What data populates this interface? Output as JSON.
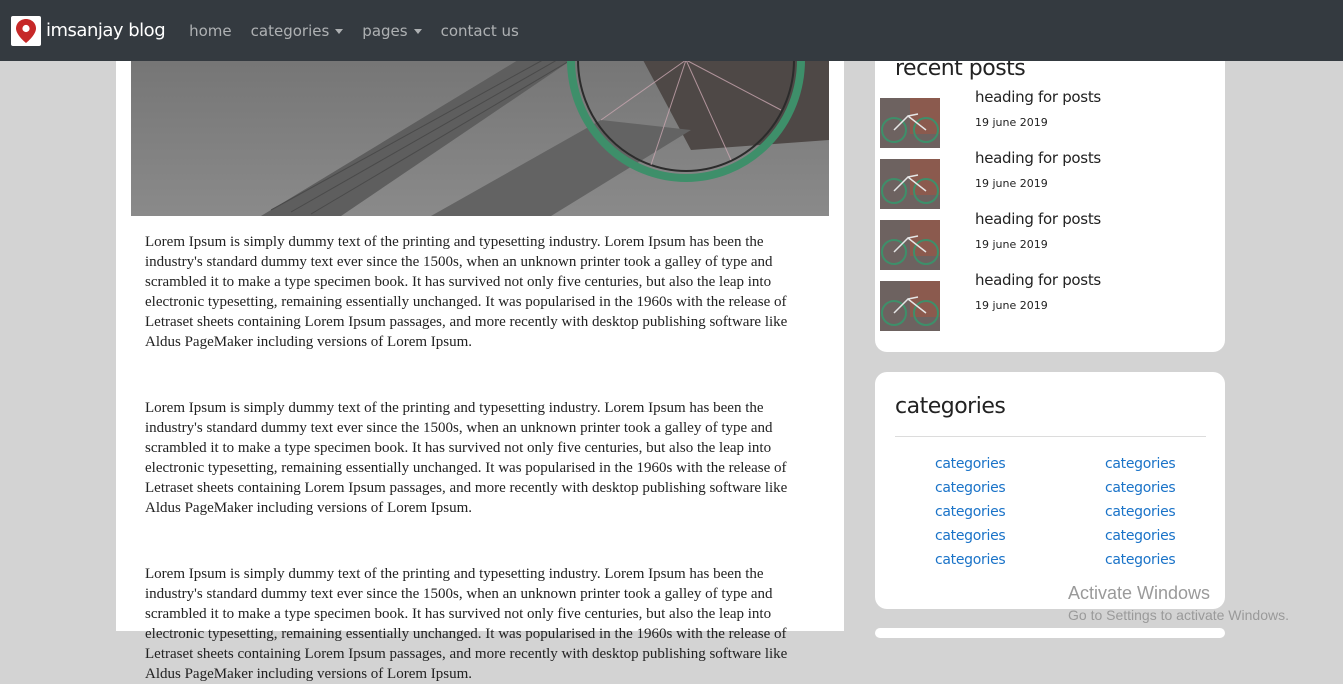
{
  "navbar": {
    "brand": "imsanjay blog",
    "links": [
      "home",
      "categories",
      "pages",
      "contact us"
    ]
  },
  "main": {
    "paragraphs": [
      "Lorem Ipsum is simply dummy text of the printing and typesetting industry. Lorem Ipsum has been the industry's standard dummy text ever since the 1500s, when an unknown printer took a galley of type and scrambled it to make a type specimen book. It has survived not only five centuries, but also the leap into electronic typesetting, remaining essentially unchanged. It was popularised in the 1960s with the release of Letraset sheets containing Lorem Ipsum passages, and more recently with desktop publishing software like Aldus PageMaker including versions of Lorem Ipsum.",
      "Lorem Ipsum is simply dummy text of the printing and typesetting industry. Lorem Ipsum has been the industry's standard dummy text ever since the 1500s, when an unknown printer took a galley of type and scrambled it to make a type specimen book. It has survived not only five centuries, but also the leap into electronic typesetting, remaining essentially unchanged. It was popularised in the 1960s with the release of Letraset sheets containing Lorem Ipsum passages, and more recently with desktop publishing software like Aldus PageMaker including versions of Lorem Ipsum.",
      "Lorem Ipsum is simply dummy text of the printing and typesetting industry. Lorem Ipsum has been the industry's standard dummy text ever since the 1500s, when an unknown printer took a galley of type and scrambled it to make a type specimen book. It has survived not only five centuries, but also the leap into electronic typesetting, remaining essentially unchanged. It was popularised in the 1960s with the release of Letraset sheets containing Lorem Ipsum passages, and more recently with desktop publishing software like Aldus PageMaker including versions of Lorem Ipsum."
    ]
  },
  "recent_posts": {
    "title": "recent posts",
    "items": [
      {
        "heading": "heading for posts",
        "date": "19 june 2019"
      },
      {
        "heading": "heading for posts",
        "date": "19 june 2019"
      },
      {
        "heading": "heading for posts",
        "date": "19 june 2019"
      },
      {
        "heading": "heading for posts",
        "date": "19 june 2019"
      }
    ]
  },
  "categories_card": {
    "title": "categories",
    "left": [
      "categories",
      "categories",
      "categories",
      "categories",
      "categories"
    ],
    "right": [
      "categories",
      "categories",
      "categories",
      "categories",
      "categories"
    ]
  },
  "watermark": {
    "line1": "Activate Windows",
    "line2": "Go to Settings to activate Windows."
  },
  "colors": {
    "navbar": "#343a40",
    "page_bg": "#d3d3d3",
    "link": "#1a73c8",
    "logo_pin": "#c62828"
  },
  "icons": [
    "map-pin-icon",
    "caret-down-icon"
  ]
}
